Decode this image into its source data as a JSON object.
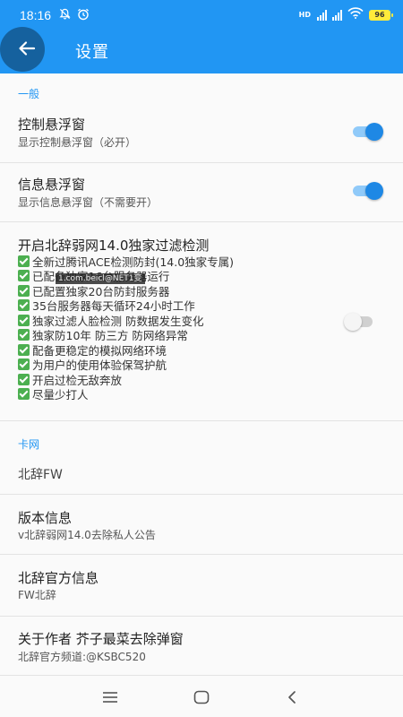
{
  "status_bar": {
    "time": "18:16",
    "network_badge": "HD",
    "battery": "96"
  },
  "header": {
    "title": "设置"
  },
  "sections": {
    "general": "一般",
    "card": "卡网"
  },
  "settings": {
    "control_float": {
      "title": "控制悬浮窗",
      "subtitle": "显示控制悬浮窗（必开）",
      "enabled": true
    },
    "info_float": {
      "title": "信息悬浮窗",
      "subtitle": "显示信息悬浮窗（不需要开）",
      "enabled": true
    },
    "filter": {
      "title": "开启北辞弱网14.0独家过滤检测",
      "enabled": false,
      "items": [
        "全新过腾讯ACE检测防封(14.0独家专属)",
        "已配备独家16台服务器运行",
        "已配置独家20台防封服务器",
        "35台服务器每天循环24小时工作",
        "独家过滤人脸检测 防数据发生变化",
        "独家防10年 防三方 防网络异常",
        "配备更稳定的模拟网络环境",
        "为用户的使用体验保驾护航",
        "开启过检无敌奔放",
        "尽量少打人"
      ]
    },
    "card_name": {
      "title": "北辞FW"
    },
    "version": {
      "title": "版本信息",
      "subtitle": "v北辞弱网14.0去除私人公告"
    },
    "official": {
      "title": "北辞官方信息",
      "subtitle": "FW北辞"
    },
    "about": {
      "title": "关于作者 芥子最菜去除弹窗",
      "subtitle": "北辞官方频道:@KSBC520"
    }
  },
  "watermark": "1.com.beicl@NET1变",
  "colors": {
    "accent": "#2196f3",
    "toggle_on": "#1e88e5",
    "check": "#4caf50"
  },
  "icons": {
    "back": "arrow-left-icon",
    "alarm": "alarm-icon",
    "silent": "bell-off-icon",
    "wifi": "wifi-icon"
  }
}
